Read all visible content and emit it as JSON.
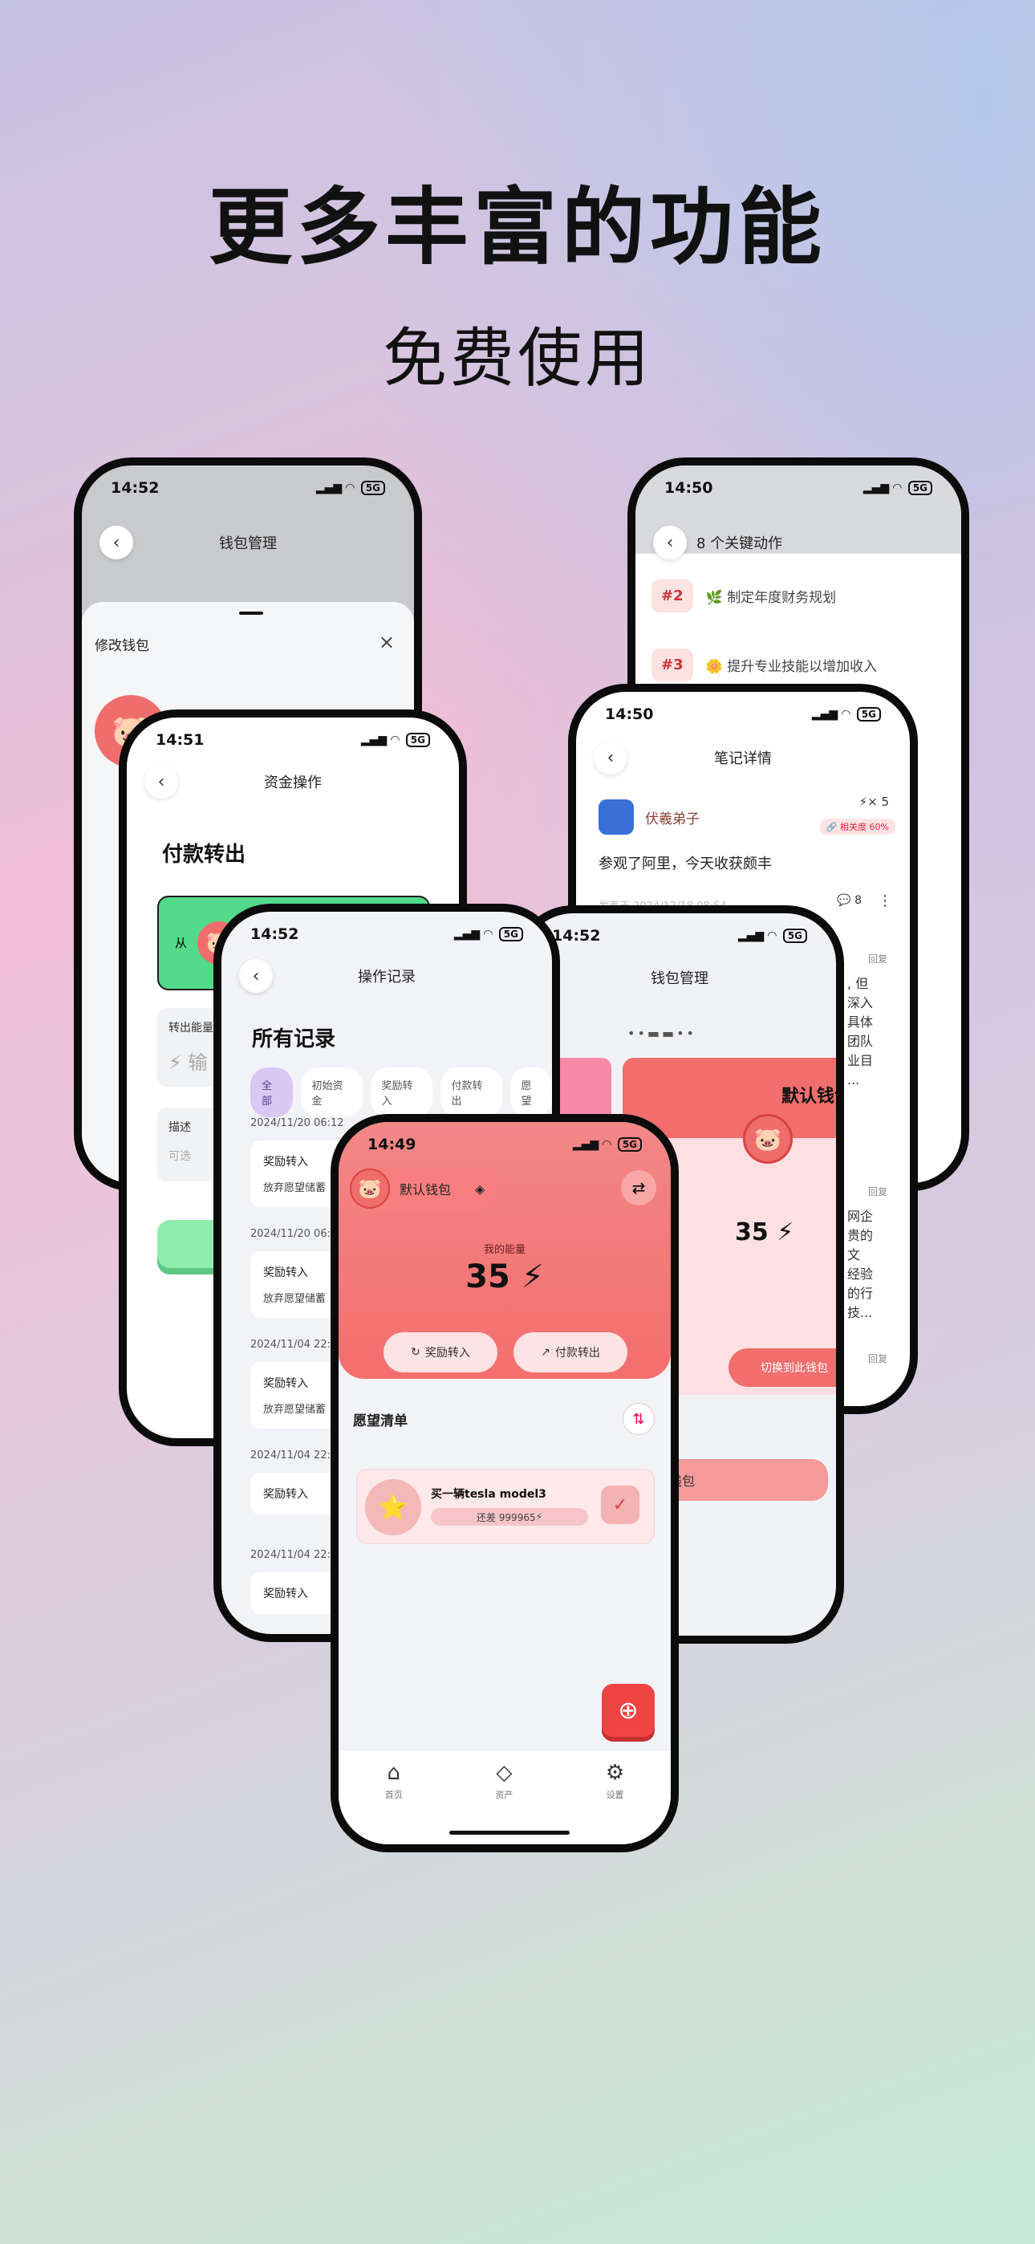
{
  "headline": {
    "title": "更多丰富的功能",
    "subtitle": "免费使用"
  },
  "phone_wallet_edit": {
    "time": "14:52",
    "nav_title": "钱包管理",
    "sheet_title": "修改钱包",
    "close": "×"
  },
  "phone_actions": {
    "time": "14:50",
    "title": "8 个关键动作",
    "items": [
      {
        "badge": "#2",
        "icon": "🌿",
        "text": "制定年度财务规划"
      },
      {
        "badge": "#3",
        "icon": "🌼",
        "text": "提升专业技能以增加收入"
      }
    ]
  },
  "phone_payment": {
    "time": "14:51",
    "nav_title": "资金操作",
    "heading": "付款转出",
    "from_label": "从",
    "amount_label": "转出能量",
    "amount_placeholder": "输",
    "desc_label": "描述",
    "desc_placeholder": "可选"
  },
  "phone_note": {
    "time": "14:50",
    "nav_title": "笔记详情",
    "author": "伏羲弟子",
    "energy": "× 5",
    "relevance": "相关度 60%",
    "content": "参观了阿里，今天收获颇丰",
    "meta": "发表于 2024/12/18 08:54",
    "comments": "8",
    "reply_label": "回复",
    "reply_snippets": [
      ", 但",
      "深入",
      "具体",
      "团队",
      "业目",
      "...",
      "网企",
      "贵的",
      "文",
      "经验",
      "的行",
      "技..."
    ]
  },
  "phone_wallet": {
    "time": "14:52",
    "nav_title": "钱包管理",
    "card_title": "默认钱包",
    "energy": "35",
    "switch_label": "切换到此钱包",
    "wide_label": "除钱包"
  },
  "phone_records": {
    "time": "14:52",
    "nav_title": "操作记录",
    "heading": "所有记录",
    "tabs": [
      "全部",
      "初始资金",
      "奖励转入",
      "付款转出",
      "愿望"
    ],
    "records": [
      {
        "date": "2024/11/20 06:12",
        "type": "奖励转入",
        "desc": "放弃愿望储蓄"
      },
      {
        "date": "2024/11/20 06:1",
        "type": "奖励转入",
        "desc": "放弃愿望储蓄"
      },
      {
        "date": "2024/11/04 22:2",
        "type": "奖励转入",
        "desc": "放弃愿望储蓄"
      },
      {
        "date": "2024/11/04 22:",
        "type": "奖励转入",
        "desc": ""
      },
      {
        "date": "2024/11/04 22:",
        "type": "奖励转入",
        "desc": ""
      }
    ]
  },
  "phone_main": {
    "time": "14:49",
    "wallet_name": "默认钱包",
    "energy_label": "我的能量",
    "energy": "35",
    "reward_in": "奖励转入",
    "pay_out": "付款转出",
    "wishlist_title": "愿望清单",
    "wish": {
      "name": "买一辆tesla model3",
      "remaining": "还差 999965"
    },
    "tabbar": [
      {
        "icon": "home-icon",
        "glyph": "⌂",
        "label": "首页"
      },
      {
        "icon": "diamond-icon",
        "glyph": "◇",
        "label": "资产"
      },
      {
        "icon": "settings-icon",
        "glyph": "⚙",
        "label": "设置"
      }
    ]
  },
  "colors": {
    "accent": "#f46e6e",
    "green": "#52d98a",
    "purple": "#d9c7f4"
  }
}
